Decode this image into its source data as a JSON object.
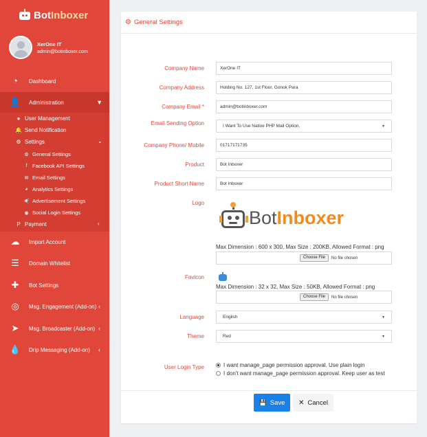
{
  "brand": {
    "part1": "Bot",
    "part2": "Inboxer"
  },
  "user": {
    "name": "XerOne IT",
    "email": "admin@botinboxer.com"
  },
  "nav": {
    "dashboard": "Dashboard",
    "administration": "Administration",
    "user_management": "User Management",
    "send_notification": "Send Notification",
    "settings": "Settings",
    "general_settings": "General Settings",
    "facebook_api": "Facebook API Settings",
    "email_settings": "Email Settings",
    "analytics_settings": "Analytics Settings",
    "advertisement_settings": "Advertisement Settings",
    "social_login_settings": "Social Login Settings",
    "payment": "Payment",
    "import_account": "Import Account",
    "domain_whitelist": "Domain Whitelist",
    "bot_settings": "Bot Settings",
    "msg_engagement": "Msg. Engagement (Add-on)",
    "msg_broadcaster": "Msg. Broadcaster (Add-on)",
    "drip_messaging": "Drip Messaging (Add-on)"
  },
  "card": {
    "title": "General Settings"
  },
  "form": {
    "company_name": {
      "label": "Company Name",
      "value": "XerOne IT"
    },
    "company_address": {
      "label": "Company Address",
      "value": "Holding No. 127, 1st Floor, Gonok Para"
    },
    "company_email": {
      "label": "Company Email *",
      "value": "admin@botinboxer.com"
    },
    "email_option": {
      "label": "Email Sending Option",
      "value": "I Want To Use Native PHP Mail Option."
    },
    "company_phone": {
      "label": "Company Phone/ Mobile",
      "value": "01717171735"
    },
    "product": {
      "label": "Product",
      "value": "Bot Inboxer"
    },
    "product_short": {
      "label": "Product Short Name",
      "value": "Bot Inboxer"
    },
    "logo": {
      "label": "Logo",
      "help": "Max Dimension : 600 x 300, Max Size : 200KB, Allowed Format : png",
      "choose": "Choose File",
      "no_file": "No file chosen"
    },
    "favicon": {
      "label": "Favicon",
      "help": "Max Dimension : 32 x 32, Max Size : 50KB, Allowed Format : png",
      "choose": "Choose File",
      "no_file": "No file chosen"
    },
    "language": {
      "label": "Language",
      "value": "English"
    },
    "theme": {
      "label": "Theme",
      "value": "Red"
    },
    "login_type": {
      "label": "User Login Type",
      "option1": "I want manage_page permission approval. Use plain login",
      "option2": "I don't want manage_page permission approval. Keep user as test",
      "selected": 1
    }
  },
  "actions": {
    "save": "Save",
    "cancel": "Cancel"
  },
  "colors": {
    "sidebar": "#e0473a",
    "accent": "#e0473a",
    "save_button": "#1a7fe6"
  }
}
